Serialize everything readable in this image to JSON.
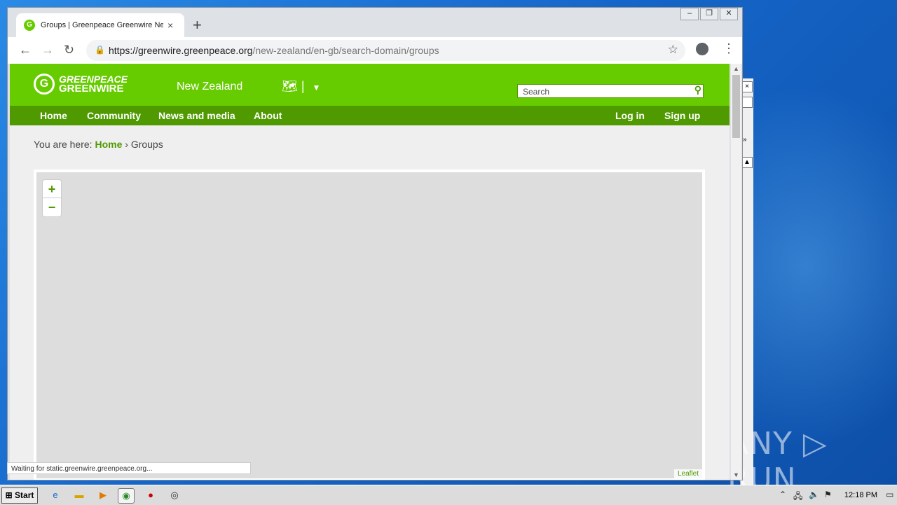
{
  "browser": {
    "tab_title": "Groups | Greenpeace Greenwire New Zealand",
    "tab_close": "×",
    "new_tab": "+",
    "url_host": "https://greenwire.greenpeace.org",
    "url_path": "/new-zealand/en-gb/search-domain/groups",
    "status_text": "Waiting for static.greenwire.greenpeace.org..."
  },
  "site": {
    "logo_line1": "GREENPEACE",
    "logo_line2": "GREENWIRE",
    "region": "New Zealand",
    "search_placeholder": "Search",
    "nav": [
      "Home",
      "Community",
      "News and media",
      "About"
    ],
    "auth": [
      "Log in",
      "Sign up"
    ],
    "breadcrumb_prefix": "You are here:",
    "breadcrumb_home": "Home",
    "breadcrumb_sep": "›",
    "breadcrumb_current": "Groups",
    "zoom_in": "+",
    "zoom_out": "−",
    "map_attribution": "Leaflet"
  },
  "colors": {
    "brand_green": "#66cc00",
    "nav_green": "#4e9a00"
  },
  "taskbar": {
    "start": "Start",
    "clock": "12:18 PM"
  },
  "desktop": {
    "watermark": "ANY ▷ RUN"
  }
}
